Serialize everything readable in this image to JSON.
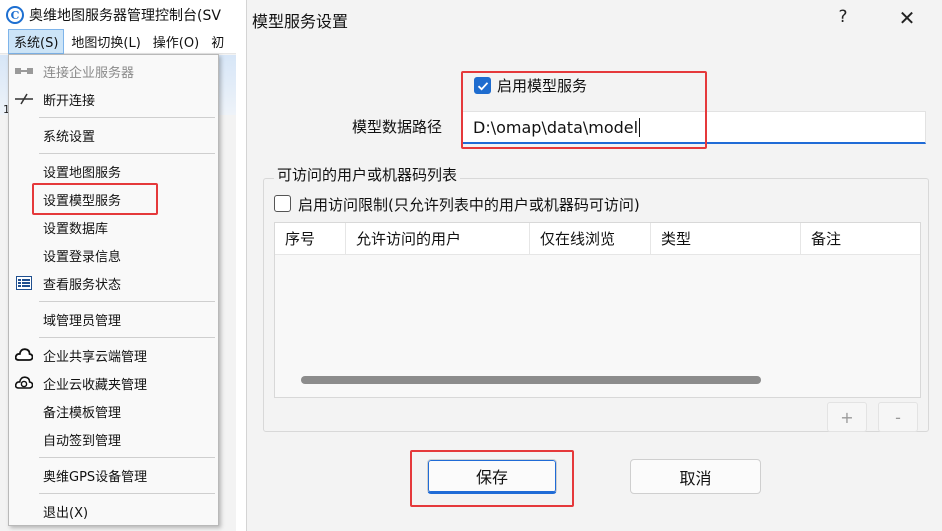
{
  "app": {
    "logo_letter": "C",
    "title": "奥维地图服务器管理控制台(SV",
    "menubar": [
      {
        "label": "系统(S)",
        "active": true
      },
      {
        "label": "地图切换(L)",
        "active": false
      },
      {
        "label": "操作(O)",
        "active": false
      },
      {
        "label": "初",
        "active": false
      }
    ],
    "strip_number": "1"
  },
  "system_menu": {
    "items": [
      {
        "label": "连接企业服务器",
        "icon": "connect-icon",
        "disabled": true
      },
      {
        "label": "断开连接",
        "icon": "disconnect-icon",
        "disabled": false
      },
      {
        "label": "系统设置",
        "icon": "",
        "disabled": false
      },
      {
        "label": "设置地图服务",
        "icon": "",
        "disabled": false
      },
      {
        "label": "设置模型服务",
        "icon": "",
        "disabled": false
      },
      {
        "label": "设置数据库",
        "icon": "",
        "disabled": false
      },
      {
        "label": "设置登录信息",
        "icon": "",
        "disabled": false
      },
      {
        "label": "查看服务状态",
        "icon": "list-icon",
        "disabled": false
      },
      {
        "label": "域管理员管理",
        "icon": "",
        "disabled": false
      },
      {
        "label": "企业共享云端管理",
        "icon": "cloud-icon",
        "disabled": false
      },
      {
        "label": "企业云收藏夹管理",
        "icon": "cloud-sync-icon",
        "disabled": false
      },
      {
        "label": "备注模板管理",
        "icon": "",
        "disabled": false
      },
      {
        "label": "自动签到管理",
        "icon": "",
        "disabled": false
      },
      {
        "label": "奥维GPS设备管理",
        "icon": "",
        "disabled": false
      },
      {
        "label": "退出(X)",
        "icon": "",
        "disabled": false
      }
    ]
  },
  "dialog": {
    "title": "模型服务设置",
    "help_label": "?",
    "close_label": "✕",
    "enable_model_service": {
      "label": "启用模型服务",
      "checked": true
    },
    "model_path": {
      "label": "模型数据路径",
      "value": "D:\\omap\\data\\model"
    },
    "access_group": {
      "title": "可访问的用户或机器码列表",
      "enable_restriction": {
        "label": "启用访问限制(只允许列表中的用户或机器码可访问)",
        "checked": false
      },
      "columns": [
        "序号",
        "允许访问的用户",
        "仅在线浏览",
        "类型",
        "备注"
      ],
      "rows": [],
      "add_label": "+",
      "remove_label": "-"
    },
    "save_label": "保存",
    "cancel_label": "取消"
  },
  "colors": {
    "accent": "#1e6ccf",
    "highlight": "#e5393b"
  }
}
